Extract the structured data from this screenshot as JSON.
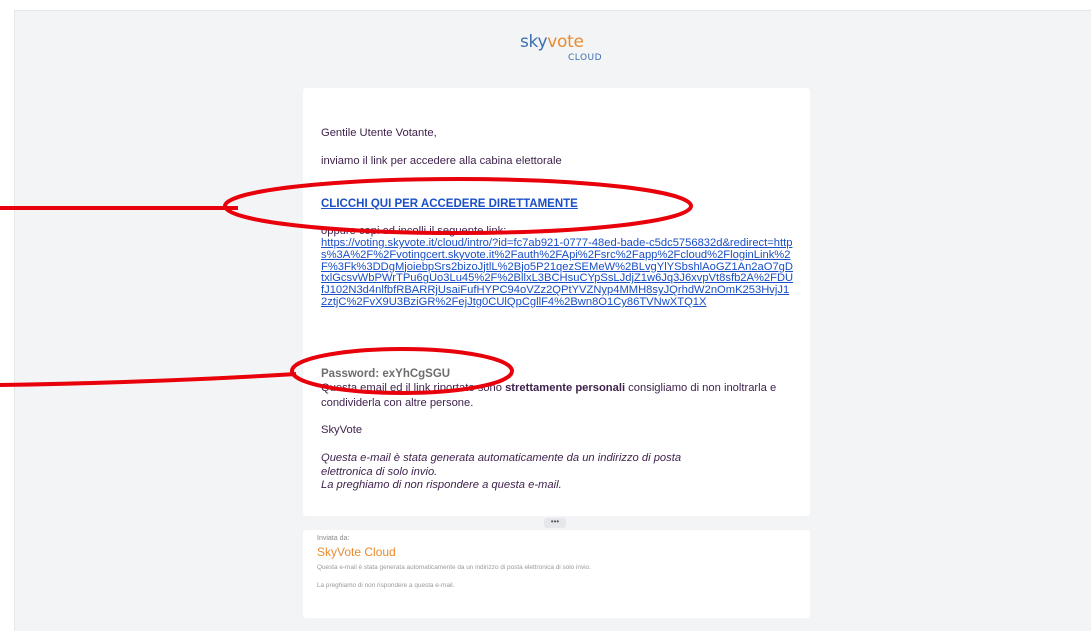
{
  "brand": {
    "logo_left": "sky",
    "logo_vote": "vote",
    "logo_cloud": "CLOUD"
  },
  "email": {
    "greeting": "Gentile Utente Votante,",
    "intro": "inviamo il link per accedere alla cabina elettorale",
    "cta_label": "CLICCHI QUI PER ACCEDERE DIRETTAMENTE",
    "alt_text": "oppure copi ed incolli il seguente link:",
    "long_link": "https://voting.skyvote.it/cloud/intro/?id=fc7ab921-0777-48ed-bade-c5dc5756832d&redirect=https%3A%2F%2Fvotingcert.skyvote.it%2Fauth%2FApi%2Fsrc%2Fapp%2Fcloud%2FloginLink%2F%3Fk%3DDgMjoiebpSrs2bizoJjtlL%2Bjo5P21qezSEMeW%2BLvgYlYSbshlAoGZ1An2aO7gDtxlGcsvWbPWrTPu6gUo3Lu45%2F%2BllxL3BCHsuCYpSsLJdjZ1w6Jq3J6xvpVt8sfb2A%2FDUfJ102N3d4nlfbfRBARRjUsaiFufHYPC94oVZz2QPtYVZNyp4MMH8syJQrhdW2nOmK253HvjJ12ztjC%2FvX9U3BziGR%2FejJtg0CUlQpCgllF4%2Bwn8O1Cy86TVNwXTQ1X",
    "password": "Password: exYhCgSGU",
    "notice_pre": "Questa email ed il link riportato sono ",
    "notice_bold": "strettamente personali",
    "notice_post": " consigliamo di non inoltrarla e condividerla con altre persone.",
    "signature": "SkyVote",
    "auto_line1": "Questa e-mail è stata generata automaticamente da un indirizzo di posta",
    "auto_line2": "elettronica di solo invio.",
    "auto_line3": "La preghiamo di non rispondere a questa e-mail."
  },
  "expander": {
    "label": "•••"
  },
  "footer": {
    "sent_by": "Inviata da:",
    "brand": "SkyVote Cloud",
    "line1": "Questa e-mail è stata generata automaticamente da un indirizzo di posta elettronica di solo invio.",
    "line2": "La preghiamo di non rispondere a questa e-mail."
  },
  "annotation": {
    "color": "#e8000a"
  }
}
